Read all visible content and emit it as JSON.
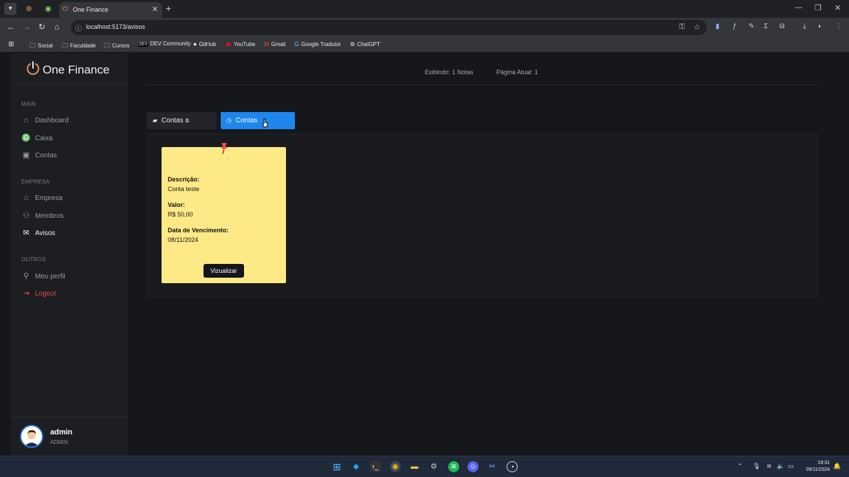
{
  "browser": {
    "tab_title": "One Finance",
    "url": "localhost:5173/avisos",
    "bookmarks": [
      "Social",
      "Faculdade",
      "Cursos",
      "DEV Community",
      "GitHub",
      "YouTube",
      "Gmail",
      "Google Tradutor",
      "ChatGPT"
    ],
    "bookmark_icons": [
      "folder-icon",
      "folder-icon",
      "folder-icon",
      "dev-icon",
      "github-icon",
      "youtube-icon",
      "gmail-icon",
      "translate-icon",
      "chatgpt-icon"
    ]
  },
  "sidebar": {
    "brand": "One Finance",
    "sections": {
      "main": "MAIN",
      "empresa": "EMPRESA",
      "outros": "OUTROS"
    },
    "items": {
      "dashboard": "Dashboard",
      "caixa": "Caixa",
      "contas": "Contas",
      "empresa": "Empresa",
      "membros": "Membros",
      "avisos": "Avisos",
      "perfil": "Meu perfil",
      "logout": "Logout"
    },
    "profile": {
      "name": "admin",
      "role": "ADMIN"
    }
  },
  "main": {
    "showing": "Exibindo: 1 Notas",
    "page": "Página Atual: 1",
    "tabs": {
      "due": "Contas a Vencer",
      "overdue": "Contas Atrasadas"
    },
    "note": {
      "desc_label": "Descrição:",
      "desc_value": "Conta teste",
      "value_label": "Valor:",
      "value_value": "R$ 50,00",
      "due_label": "Data de Vencimento:",
      "due_value": "08/11/2024",
      "button": "Vizualizar"
    }
  },
  "taskbar": {
    "time": "19:31",
    "date": "09/11/2024"
  },
  "colors": {
    "accent": "#1f86ee",
    "note": "#fdea87",
    "logout": "#e5484d",
    "background": "#16171b"
  }
}
